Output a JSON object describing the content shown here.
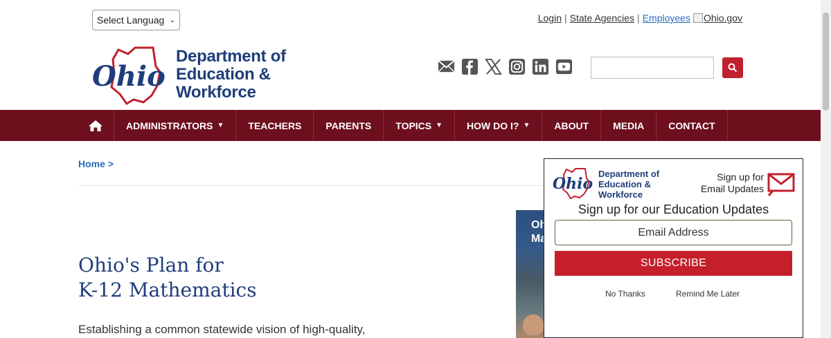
{
  "language_select": {
    "value": "Select Languag"
  },
  "top_links": {
    "login": "Login",
    "state_agencies": "State Agencies",
    "employees": "Employees",
    "ohio_gov": "Ohio.gov",
    "separator": "|"
  },
  "logo": {
    "line1": "Department of",
    "line2": "Education &",
    "line3": "Workforce"
  },
  "social_icons": [
    "email-icon",
    "facebook-icon",
    "x-icon",
    "instagram-icon",
    "linkedin-icon",
    "youtube-icon"
  ],
  "search": {
    "placeholder": ""
  },
  "nav": {
    "items": [
      {
        "label": "ADMINISTRATORS",
        "caret": "▼"
      },
      {
        "label": "TEACHERS"
      },
      {
        "label": "PARENTS"
      },
      {
        "label": "TOPICS",
        "caret": "▼"
      },
      {
        "label": "HOW DO I?",
        "caret": "▼"
      },
      {
        "label": "ABOUT"
      },
      {
        "label": "MEDIA"
      },
      {
        "label": "CONTACT"
      }
    ]
  },
  "breadcrumb": {
    "home": "Home >"
  },
  "page": {
    "title_line1": "Ohio's Plan for",
    "title_line2": "K-12 Mathematics",
    "intro": "Establishing a common statewide vision of high-quality,"
  },
  "book": {
    "text": "Oh\nMa"
  },
  "popup": {
    "logo_line1": "Department of",
    "logo_line2": "Education &",
    "logo_line3": "Workforce",
    "signup_line1": "Sign up for",
    "signup_line2": "Email Updates",
    "title": "Sign up for our Education Updates",
    "email_placeholder": "Email Address",
    "subscribe": "SUBSCRIBE",
    "no_thanks": "No Thanks",
    "remind_later": "Remind Me Later"
  },
  "colors": {
    "nav_bg": "#6e0f1e",
    "brand_blue": "#1f3d7a",
    "accent_red": "#c1202d"
  }
}
